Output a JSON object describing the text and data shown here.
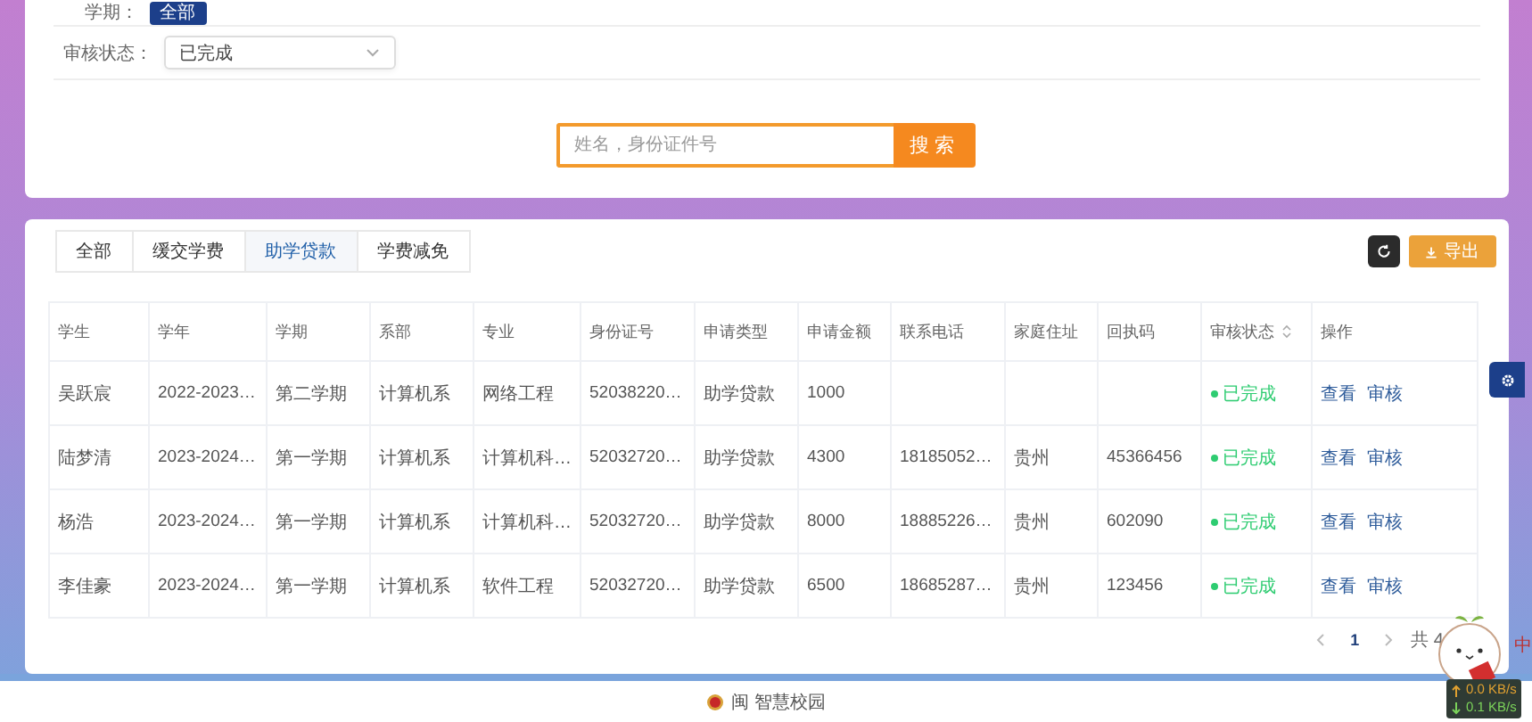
{
  "filters": [
    {
      "kind": "chips",
      "label": "学期：",
      "options": [
        {
          "label": "全部",
          "selected": true
        }
      ]
    },
    {
      "kind": "select",
      "label": "审核状态：",
      "value": "已完成"
    }
  ],
  "search": {
    "placeholder": "姓名，身份证件号",
    "button": "搜索"
  },
  "tabs": [
    {
      "label": "全部",
      "selected": false
    },
    {
      "label": "缓交学费",
      "selected": false
    },
    {
      "label": "助学贷款",
      "selected": true
    },
    {
      "label": "学费减免",
      "selected": false
    }
  ],
  "toolbar": {
    "export": "导出"
  },
  "table": {
    "columns": [
      {
        "label": "学生",
        "sortable": false
      },
      {
        "label": "学年",
        "sortable": false
      },
      {
        "label": "学期",
        "sortable": false
      },
      {
        "label": "系部",
        "sortable": false
      },
      {
        "label": "专业",
        "sortable": false
      },
      {
        "label": "身份证号",
        "sortable": false
      },
      {
        "label": "申请类型",
        "sortable": false
      },
      {
        "label": "申请金额",
        "sortable": false
      },
      {
        "label": "联系电话",
        "sortable": false
      },
      {
        "label": "家庭住址",
        "sortable": false
      },
      {
        "label": "回执码",
        "sortable": false
      },
      {
        "label": "审核状态",
        "sortable": true
      },
      {
        "label": "操作",
        "sortable": false
      }
    ],
    "rows": [
      {
        "cells": [
          "吴跃宸",
          "2022-2023…",
          "第二学期",
          "计算机系",
          "网络工程",
          "52038220…",
          "助学贷款",
          "1000",
          "",
          "",
          ""
        ],
        "status": "已完成",
        "kind": "success",
        "actions": [
          "查看",
          "审核"
        ]
      },
      {
        "cells": [
          "陆梦清",
          "2023-2024…",
          "第一学期",
          "计算机系",
          "计算机科…",
          "52032720…",
          "助学贷款",
          "4300",
          "18185052…",
          "贵州",
          "45366456"
        ],
        "status": "已完成",
        "kind": "success",
        "actions": [
          "查看",
          "审核"
        ]
      },
      {
        "cells": [
          "杨浩",
          "2023-2024…",
          "第一学期",
          "计算机系",
          "计算机科…",
          "52032720…",
          "助学贷款",
          "8000",
          "18885226…",
          "贵州",
          "602090"
        ],
        "status": "已完成",
        "kind": "success",
        "actions": [
          "查看",
          "审核"
        ]
      },
      {
        "cells": [
          "李佳豪",
          "2023-2024…",
          "第一学期",
          "计算机系",
          "软件工程",
          "52032720…",
          "助学贷款",
          "6500",
          "18685287…",
          "贵州",
          "123456"
        ],
        "status": "已完成",
        "kind": "success",
        "actions": [
          "查看",
          "审核"
        ]
      }
    ]
  },
  "pagination": {
    "pages": [
      {
        "label": "1",
        "selected": true
      }
    ],
    "total": "共 4"
  },
  "footer": {
    "text": "闽 智慧校园"
  },
  "overlay": {
    "char": "中",
    "upload": "0.0 KB/s",
    "download": "0.1 KB/s"
  }
}
